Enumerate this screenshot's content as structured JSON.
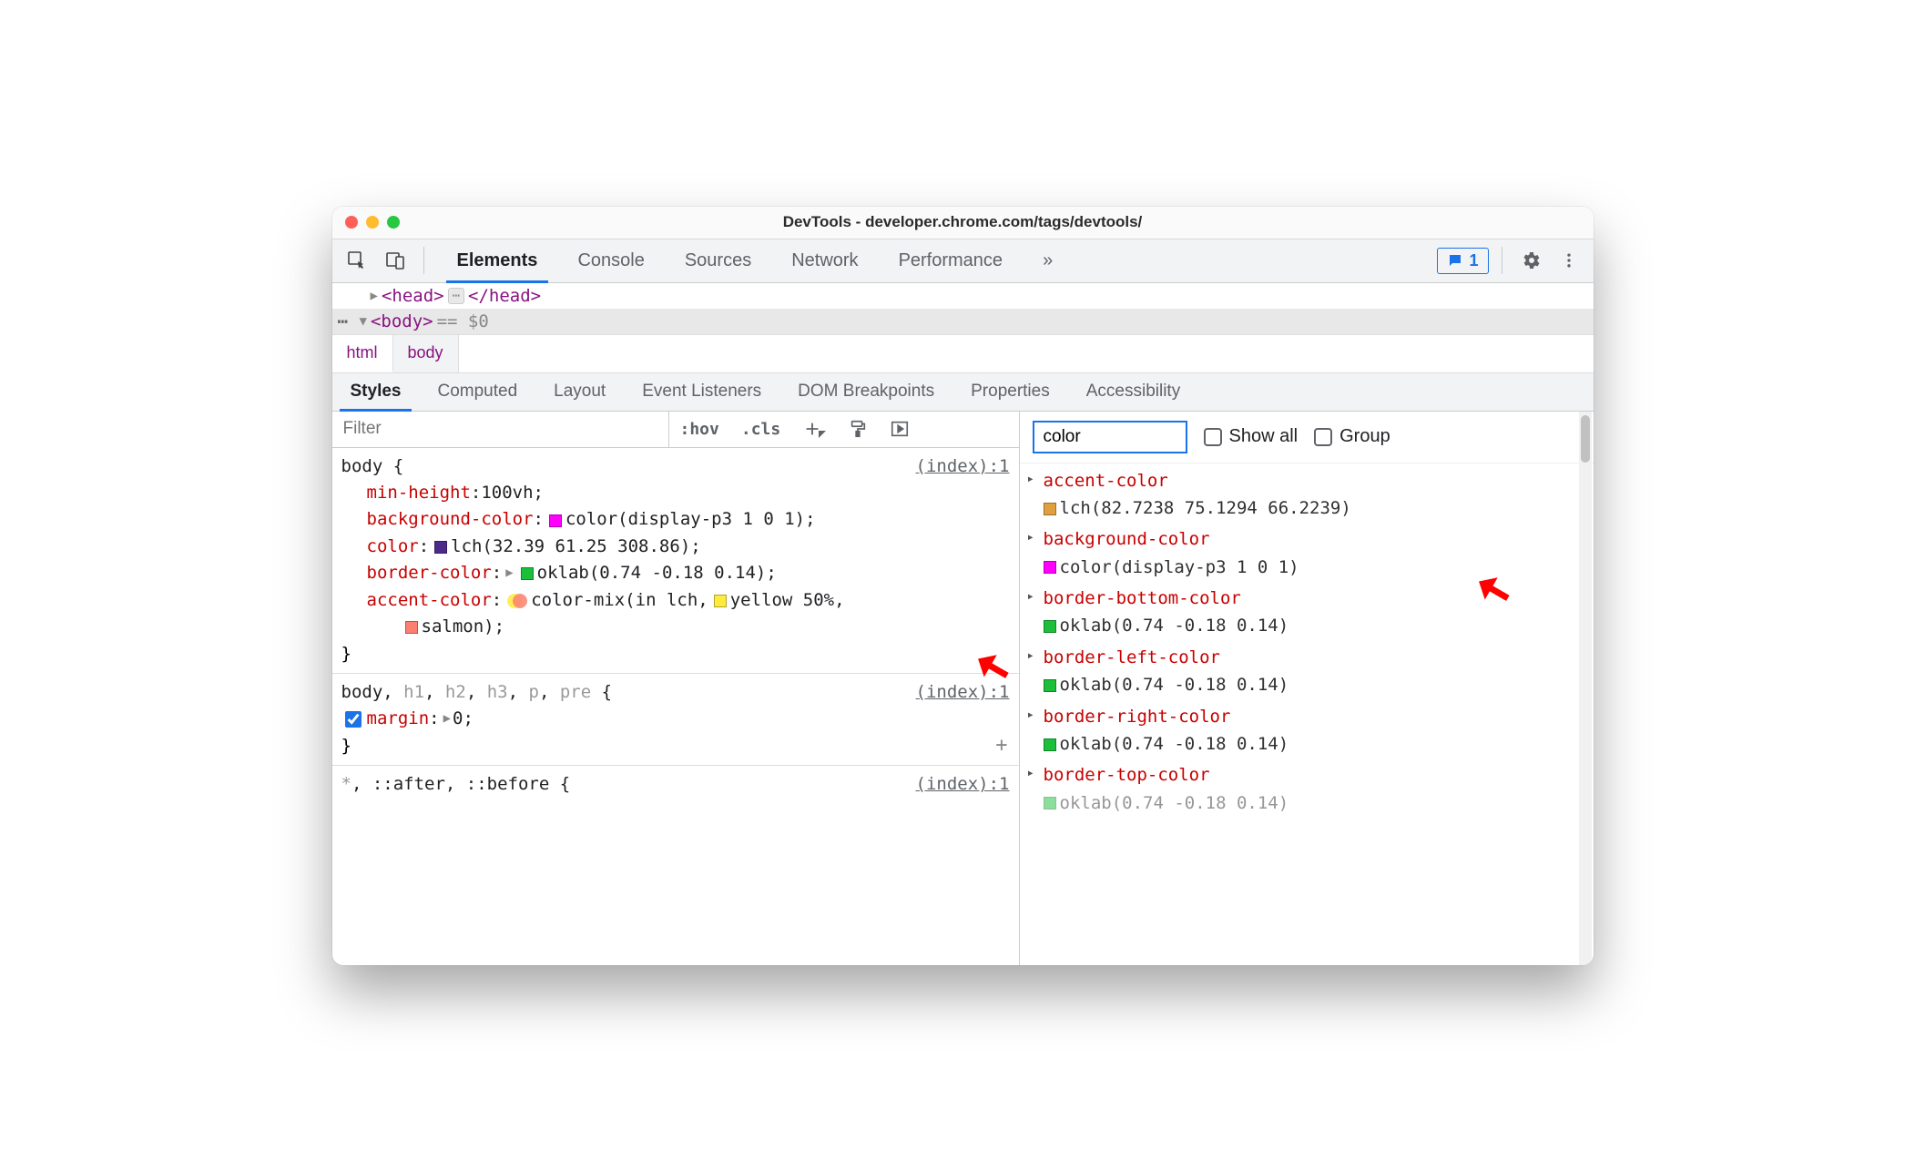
{
  "window": {
    "title": "DevTools - developer.chrome.com/tags/devtools/"
  },
  "toolbar": {
    "tabs": [
      "Elements",
      "Console",
      "Sources",
      "Network",
      "Performance"
    ],
    "more_glyph": "»",
    "issues_count": "1"
  },
  "dom": {
    "head_open": "<head>",
    "head_close": "</head>",
    "body_open": "<body>",
    "eq": "== $0"
  },
  "breadcrumb": [
    "html",
    "body"
  ],
  "subtabs": [
    "Styles",
    "Computed",
    "Layout",
    "Event Listeners",
    "DOM Breakpoints",
    "Properties",
    "Accessibility"
  ],
  "filter": {
    "placeholder": "Filter",
    "hov": ":hov",
    "cls": ".cls"
  },
  "rules": [
    {
      "selector_html": "body {",
      "source": "(index):1",
      "props": [
        {
          "name": "min-height",
          "value": "100vh",
          "swatch": null
        },
        {
          "name": "background-color",
          "value": "color(display-p3 1 0 1)",
          "swatch": "#ff00ff"
        },
        {
          "name": "color",
          "value": "lch(32.39 61.25 308.86)",
          "swatch": "#4b2a8a"
        },
        {
          "name": "border-color",
          "value": "oklab(0.74 -0.18 0.14)",
          "expand": true,
          "swatch": "#1bbf3a"
        },
        {
          "name": "accent-color",
          "value_pre": "color-mix(in lch, ",
          "mix": true,
          "yellow_sw": "#ffeb3b",
          "yellow_txt": "yellow 50%,",
          "salmon_sw": "#fa8072",
          "salmon_txt": "salmon);",
          "close_paren": ""
        }
      ],
      "close": "}"
    },
    {
      "selector_html": "body, h1, h2, h3, p, pre {",
      "dim_parts": [
        "h1",
        "h2",
        "h3",
        "p",
        "pre"
      ],
      "source": "(index):1",
      "props": [
        {
          "name": "margin",
          "value": "0",
          "expand": true,
          "checked": true
        }
      ],
      "close": "}",
      "plus": true
    },
    {
      "selector_html": "*, ::after, ::before {",
      "source": "(index):1",
      "props": [],
      "truncated": true
    }
  ],
  "computed_filter": {
    "value": "color",
    "show_all": "Show all",
    "group": "Group"
  },
  "computed": [
    {
      "name": "accent-color",
      "swatch": "#e0a040",
      "value": "lch(82.7238 75.1294 66.2239)"
    },
    {
      "name": "background-color",
      "swatch": "#ff00ff",
      "value": "color(display-p3 1 0 1)"
    },
    {
      "name": "border-bottom-color",
      "swatch": "#1bbf3a",
      "value": "oklab(0.74 -0.18 0.14)"
    },
    {
      "name": "border-left-color",
      "swatch": "#1bbf3a",
      "value": "oklab(0.74 -0.18 0.14)"
    },
    {
      "name": "border-right-color",
      "swatch": "#1bbf3a",
      "value": "oklab(0.74 -0.18 0.14)"
    },
    {
      "name": "border-top-color",
      "swatch": "#1bbf3a",
      "value": "oklab(0.74 -0.18 0.14)",
      "truncated": true
    }
  ]
}
